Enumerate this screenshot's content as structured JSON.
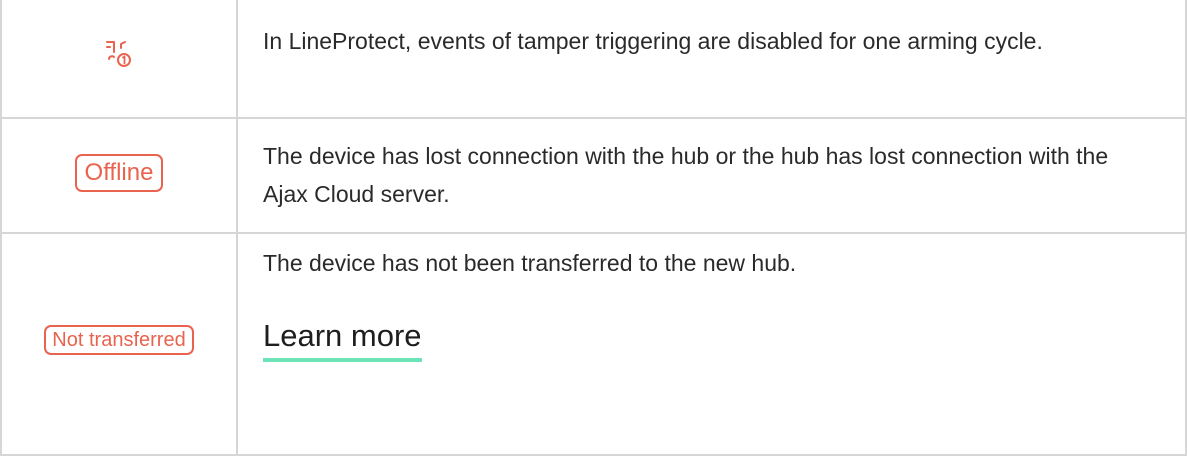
{
  "rows": [
    {
      "icon": "tamper-disabled-once-icon",
      "description": "In LineProtect, events of tamper triggering are disabled for one arming cycle."
    },
    {
      "badge": "Offline",
      "description": "The device has lost connection with the hub or the hub has lost connection with the Ajax Cloud server."
    },
    {
      "badge": "Not transferred",
      "description": "The device has not been transferred to the new hub.",
      "link": "Learn more"
    }
  ],
  "colors": {
    "status_red": "#e8644f",
    "link_underline": "#6ee3b7",
    "border": "#d6d6d6",
    "text": "#2a2a2a"
  }
}
